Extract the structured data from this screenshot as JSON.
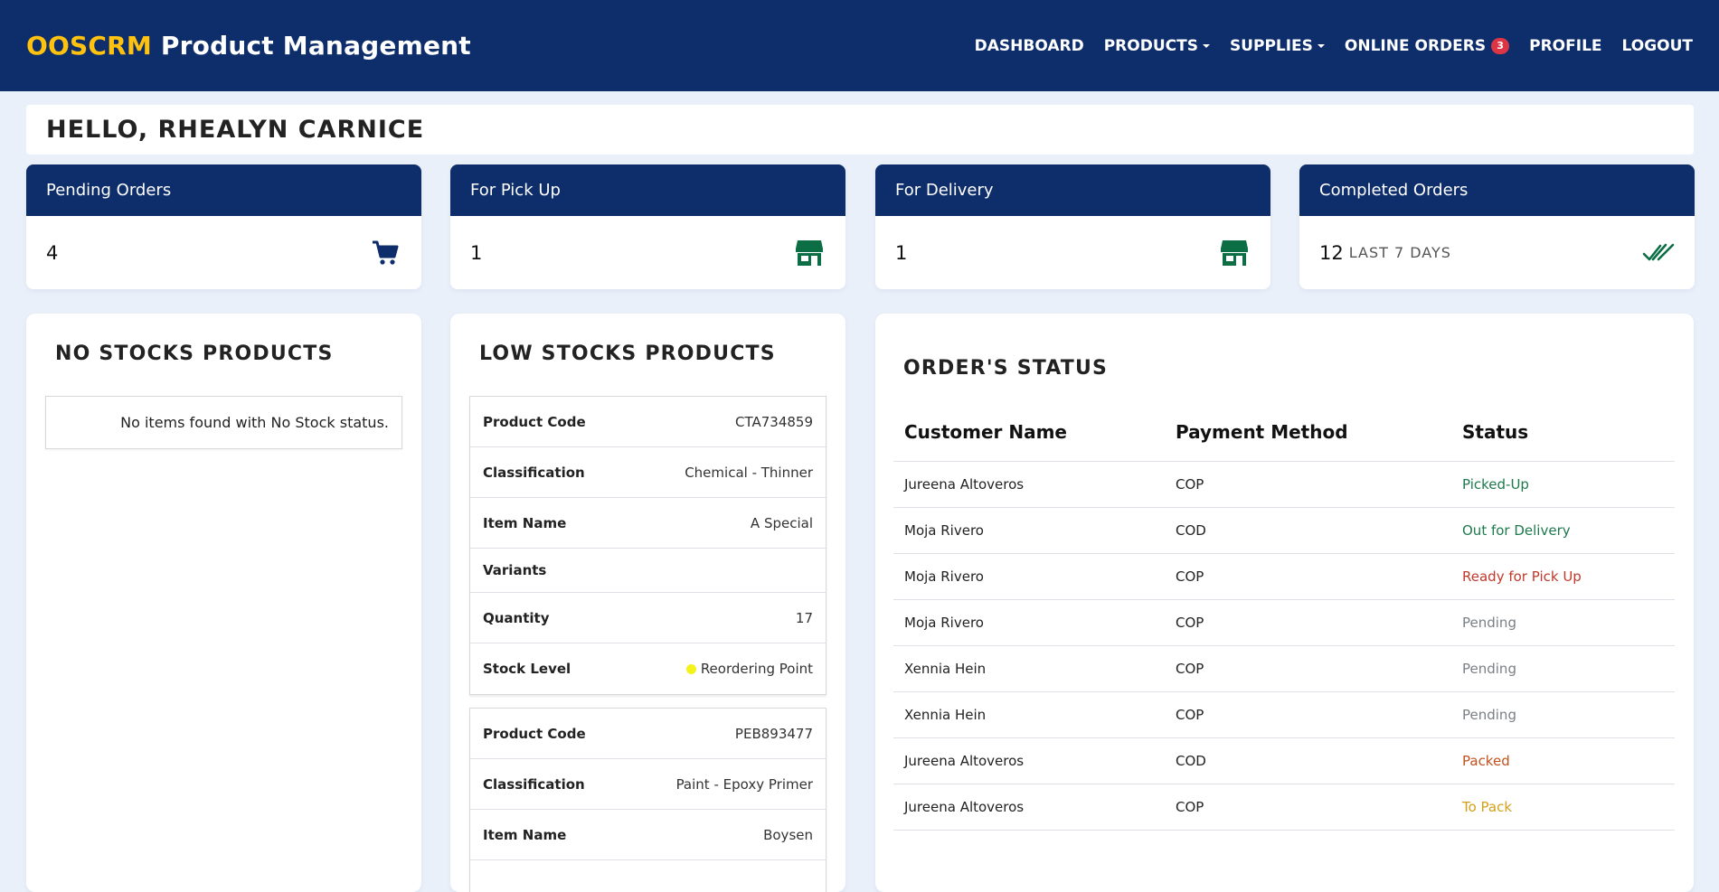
{
  "brand": {
    "accent": "OOSCRM",
    "title": "Product Management"
  },
  "nav": {
    "dashboard": "DASHBOARD",
    "products": "PRODUCTS",
    "supplies": "SUPPLIES",
    "online_orders": "ONLINE ORDERS",
    "online_orders_badge": "3",
    "profile": "PROFILE",
    "logout": "LOGOUT"
  },
  "greeting": "HELLO, RHEALYN CARNICE",
  "stats": {
    "pending": {
      "label": "Pending Orders",
      "value": "4",
      "icon": "cart-icon"
    },
    "pickup": {
      "label": "For Pick Up",
      "value": "1",
      "icon": "store-icon"
    },
    "delivery": {
      "label": "For Delivery",
      "value": "1",
      "icon": "store-icon"
    },
    "completed": {
      "label": "Completed Orders",
      "value": "12",
      "sub": "LAST 7 DAYS",
      "icon": "double-check-icon"
    }
  },
  "no_stock": {
    "title": "NO STOCKS PRODUCTS",
    "empty_message": "No items found with No Stock status."
  },
  "low_stock": {
    "title": "LOW STOCKS PRODUCTS",
    "products": [
      {
        "code_label": "Product Code",
        "code": "CTA734859",
        "class_label": "Classification",
        "classification": "Chemical - Thinner",
        "name_label": "Item Name",
        "name": "A Special",
        "variants_label": "Variants",
        "variants": "",
        "qty_label": "Quantity",
        "quantity": "17",
        "level_label": "Stock Level",
        "level": "Reordering Point"
      },
      {
        "code_label": "Product Code",
        "code": "PEB893477",
        "class_label": "Classification",
        "classification": "Paint - Epoxy Primer",
        "name_label": "Item Name",
        "name": "Boysen"
      }
    ]
  },
  "orders": {
    "title": "ORDER'S STATUS",
    "headers": [
      "Customer Name",
      "Payment Method",
      "Status"
    ],
    "rows": [
      {
        "customer": "Jureena Altoveros",
        "payment": "COP",
        "status": "Picked-Up",
        "color": "#1d7a4d"
      },
      {
        "customer": "Moja Rivero",
        "payment": "COD",
        "status": "Out for Delivery",
        "color": "#1d7a4d"
      },
      {
        "customer": "Moja Rivero",
        "payment": "COP",
        "status": "Ready for Pick Up",
        "color": "#c0392b"
      },
      {
        "customer": "Moja Rivero",
        "payment": "COP",
        "status": "Pending",
        "color": "#7b8085"
      },
      {
        "customer": "Xennia Hein",
        "payment": "COP",
        "status": "Pending",
        "color": "#7b8085"
      },
      {
        "customer": "Xennia Hein",
        "payment": "COP",
        "status": "Pending",
        "color": "#7b8085"
      },
      {
        "customer": "Jureena Altoveros",
        "payment": "COD",
        "status": "Packed",
        "color": "#c0521e"
      },
      {
        "customer": "Jureena Altoveros",
        "payment": "COP",
        "status": "To Pack",
        "color": "#d4a017"
      }
    ]
  },
  "colors": {
    "navbar": "#0e2d6b",
    "brand_accent": "#ffc20e",
    "icon_blue": "#0e2d6b",
    "icon_green": "#0b6e45",
    "badge": "#dc3545"
  }
}
